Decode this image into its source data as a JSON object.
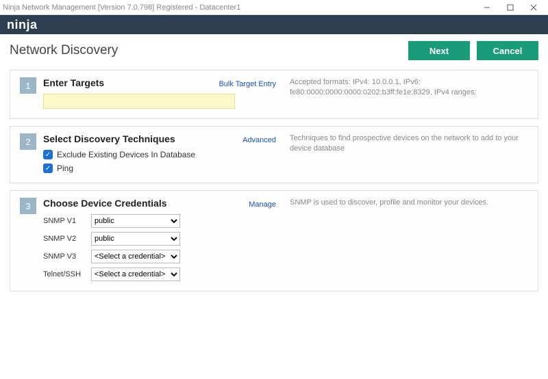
{
  "window": {
    "title": "Ninja Network Management [Version 7.0.798] Registered - Datacenter1"
  },
  "brand": "ninja",
  "page": {
    "title": "Network Discovery"
  },
  "buttons": {
    "next": "Next",
    "cancel": "Cancel"
  },
  "step1": {
    "num": "1",
    "title": "Enter Targets",
    "link": "Bulk Target Entry",
    "help": "Accepted formats: IPv4: 10.0.0.1, IPv6: fe80:0000:0000:0000:0202:b3ff:fe1e:8329, IPv4 ranges:",
    "value": ""
  },
  "step2": {
    "num": "2",
    "title": "Select Discovery Techniques",
    "link": "Advanced",
    "help": "Techniques to find prospective devices on the network to add to your device database",
    "opt1": "Exclude Existing Devices In Database",
    "opt2": "Ping"
  },
  "step3": {
    "num": "3",
    "title": "Choose Device Credentials",
    "link": "Manage",
    "help": "SNMP is used to discover, profile and monitor your devices.",
    "rows": {
      "snmpv1": {
        "label": "SNMP V1",
        "value": "public"
      },
      "snmpv2": {
        "label": "SNMP V2",
        "value": "public"
      },
      "snmpv3": {
        "label": "SNMP V3",
        "value": "<Select a credential>"
      },
      "telnet": {
        "label": "Telnet/SSH",
        "value": "<Select a credential>"
      }
    }
  }
}
